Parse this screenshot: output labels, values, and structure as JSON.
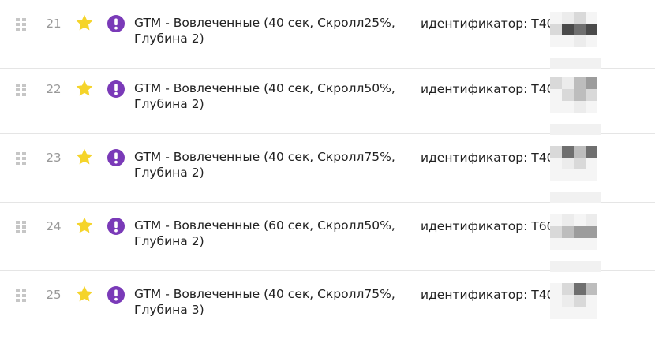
{
  "colors": {
    "star": "#f5d42a",
    "alert_badge": "#7a3ab8",
    "handle": "#c6c6c6",
    "divider": "#e5e5e5"
  },
  "icons": {
    "drag": "drag-handle-icon",
    "favorite": "star-icon",
    "alert": "exclamation-badge-icon"
  },
  "goals": [
    {
      "number": "21",
      "title": "GTM - Вовлеченные (40 сек, Скролл25%, Глубина 2)",
      "identifier": "идентификатор: Т40",
      "favorite": true
    },
    {
      "number": "22",
      "title": "GTM - Вовлеченные (40 сек, Скролл50%, Глубина 2)",
      "identifier": "идентификатор: Т40",
      "favorite": true
    },
    {
      "number": "23",
      "title": "GTM - Вовлеченные (40 сек, Скролл75%, Глубина 2)",
      "identifier": "идентификатор: Т40",
      "favorite": true
    },
    {
      "number": "24",
      "title": "GTM - Вовлеченные (60 сек, Скролл50%, Глубина 2)",
      "identifier": "идентификатор: Т60",
      "favorite": true
    },
    {
      "number": "25",
      "title": "GTM - Вовлеченные (40 сек, Скролл75%, Глубина 3)",
      "identifier": "идентификатор: Т40",
      "favorite": true
    }
  ]
}
